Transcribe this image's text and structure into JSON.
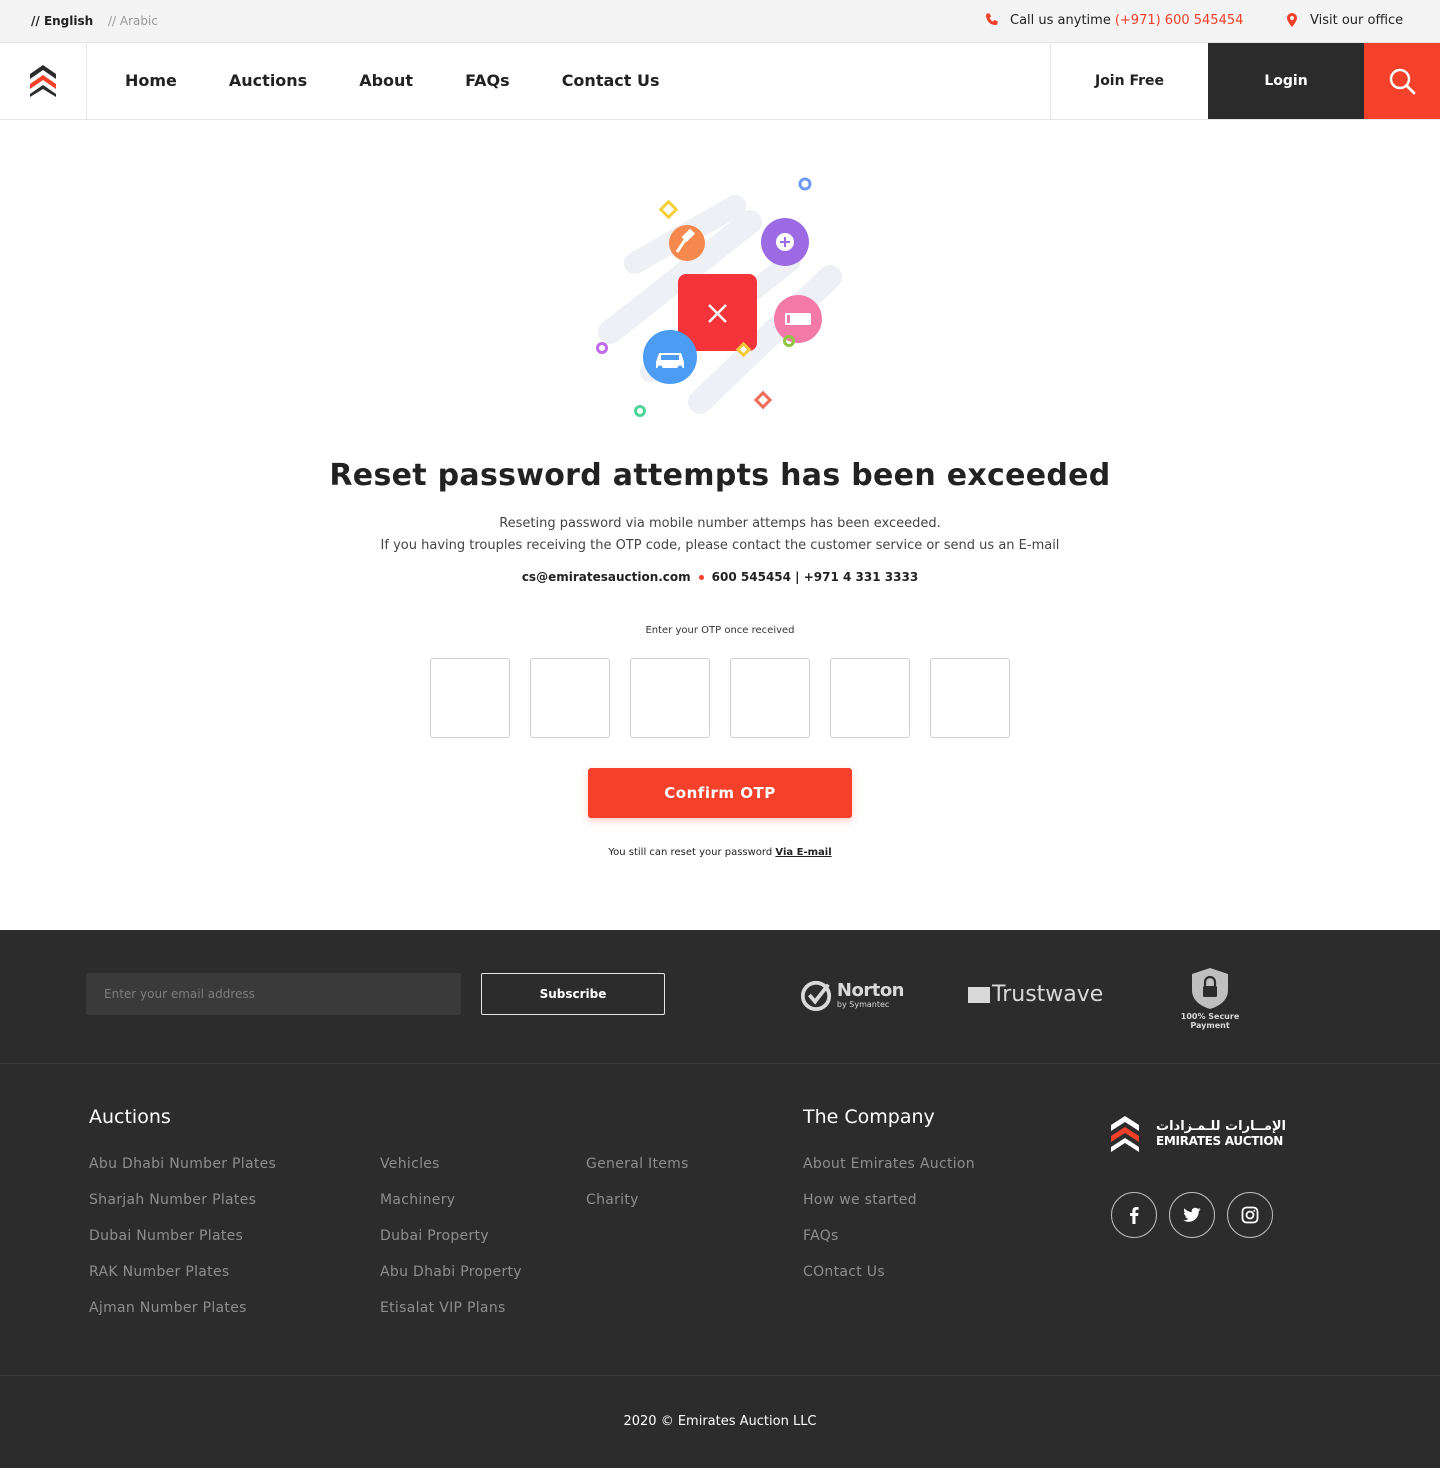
{
  "topbar": {
    "lang_en": "// English",
    "lang_ar": "// Arabic",
    "call_label": "Call us anytime",
    "call_number": "(+971) 600 545454",
    "office_label": "Visit our office"
  },
  "nav": {
    "links": [
      "Home",
      "Auctions",
      "About",
      "FAQs",
      "Contact Us"
    ],
    "join": "Join Free",
    "login": "Login"
  },
  "main": {
    "title": "Reset password attempts has been exceeded",
    "desc_line1": "Reseting password via mobile number attemps has been exceeded.",
    "desc_line2": "If you having trouples receiving the OTP code, please contact the customer service or send us an E-mail",
    "email": "cs@emiratesauction.com",
    "phones": "600 545454 | +971 4 331 3333",
    "otp_label": "Enter your OTP once received",
    "confirm": "Confirm OTP",
    "via_text": "You still can reset your password",
    "via_link": "Via E-mail"
  },
  "footer": {
    "email_placeholder": "Enter your email address",
    "subscribe": "Subscribe",
    "norton": "Norton",
    "norton_sub": "by Symantec",
    "trustwave": "Trustwave",
    "secure": "100% Secure Payment",
    "auctions_title": "Auctions",
    "auctions_col1": [
      "Abu Dhabi Number Plates",
      "Sharjah Number Plates",
      "Dubai Number Plates",
      "RAK Number Plates",
      "Ajman Number Plates"
    ],
    "auctions_col2": [
      "Vehicles",
      "Machinery",
      "Dubai Property",
      "Abu Dhabi Property",
      "Etisalat VIP Plans"
    ],
    "auctions_col3": [
      "General Items",
      "Charity"
    ],
    "company_title": "The Company",
    "company_links": [
      "About Emirates Auction",
      "How we started",
      "FAQs",
      "COntact Us"
    ],
    "brand_ar": "الإمــارات للـمـزادات",
    "brand_en": "EMIRATES AUCTION",
    "copyright": "2020 © Emirates Auction LLC"
  },
  "colors": {
    "accent": "#f5412a",
    "dark": "#2b2b2b",
    "footer_bg": "#2c2c2c"
  },
  "icons": [
    "phone-icon",
    "location-pin-icon",
    "search-icon",
    "close-icon",
    "gavel-icon",
    "plus-icon",
    "car-icon",
    "number-plate-icon",
    "facebook-icon",
    "twitter-icon",
    "instagram-icon",
    "lock-icon"
  ]
}
